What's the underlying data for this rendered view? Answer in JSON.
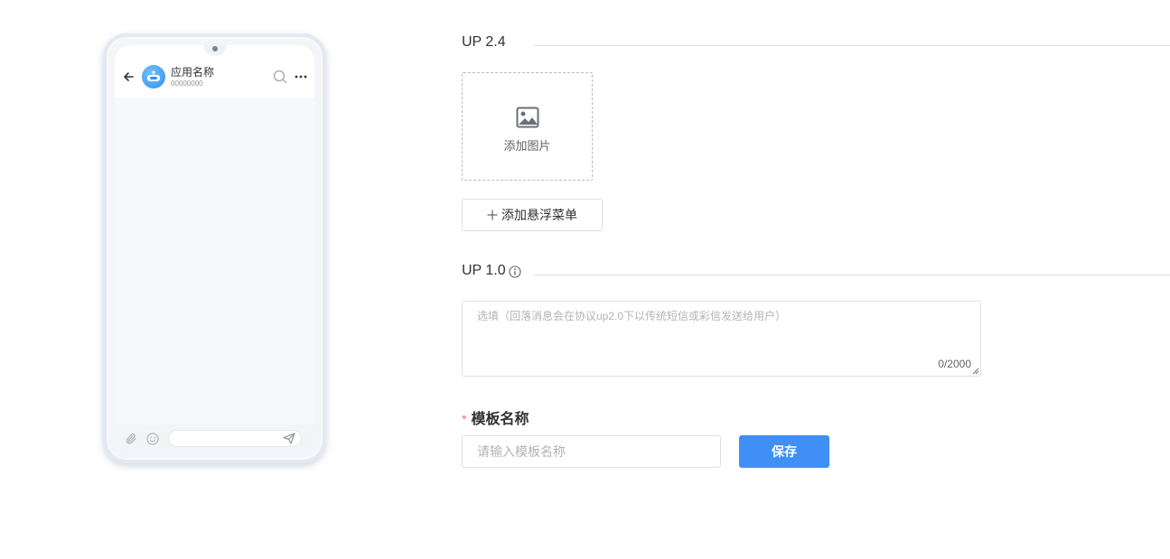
{
  "phone_preview": {
    "app_name": "应用名称",
    "app_number": "00000000",
    "icons": [
      "back-arrow-icon",
      "robot-avatar-icon",
      "search-icon",
      "more-icon",
      "attach-icon",
      "emoji-icon",
      "send-icon"
    ]
  },
  "form": {
    "up24_section": {
      "title": "UP 2.4",
      "upload_label": "添加图片",
      "add_menu_label": "添加悬浮菜单"
    },
    "up10_section": {
      "title": "UP 1.0",
      "textarea_placeholder": "选填（回落消息会在协议up2.0下以传统短信或彩信发送给用户）",
      "char_count": "0/2000"
    },
    "template_name": {
      "required_mark": "*",
      "label": "模板名称",
      "placeholder": "请输入模板名称",
      "save_label": "保存"
    }
  },
  "colors": {
    "primary": "#3f8ff4",
    "required": "#f56c6c",
    "border": "#dcdfe6",
    "avatar": "#2f8ff0"
  }
}
